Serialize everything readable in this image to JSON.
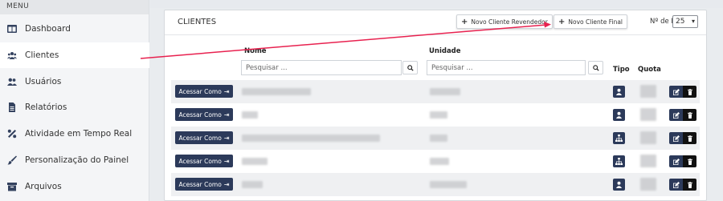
{
  "sidebar": {
    "menu_title": "MENU",
    "items": [
      {
        "label": "Dashboard",
        "icon": "dashboard-icon"
      },
      {
        "label": "Clientes",
        "icon": "users-group-icon"
      },
      {
        "label": "Usuários",
        "icon": "user-pair-icon"
      },
      {
        "label": "Relatórios",
        "icon": "report-file-icon"
      },
      {
        "label": "Atividade em Tempo Real",
        "icon": "percent-icon"
      },
      {
        "label": "Personalização do Painel",
        "icon": "brush-icon"
      },
      {
        "label": "Arquivos",
        "icon": "archive-icon"
      }
    ]
  },
  "panel": {
    "title": "CLIENTES",
    "new_reseller_label": "Novo Cliente Revendedor",
    "new_client_label": "Novo Cliente Final",
    "lines_label": "Nº de Linhas",
    "lines_value": "25"
  },
  "table": {
    "headers": {
      "name": "Nome",
      "unit": "Unidade",
      "type": "Tipo",
      "quota": "Quota"
    },
    "name_search_placeholder": "Pesquisar ...",
    "unit_search_placeholder": "Pesquisar ...",
    "access_label": "Acessar Como",
    "rows": [
      {
        "type_icon": "user-icon"
      },
      {
        "type_icon": "user-icon"
      },
      {
        "type_icon": "sitemap-icon"
      },
      {
        "type_icon": "sitemap-icon"
      },
      {
        "type_icon": "user-icon"
      }
    ]
  },
  "colors": {
    "primary": "#2c3a5a",
    "annotation_arrow": "#e8214f"
  }
}
